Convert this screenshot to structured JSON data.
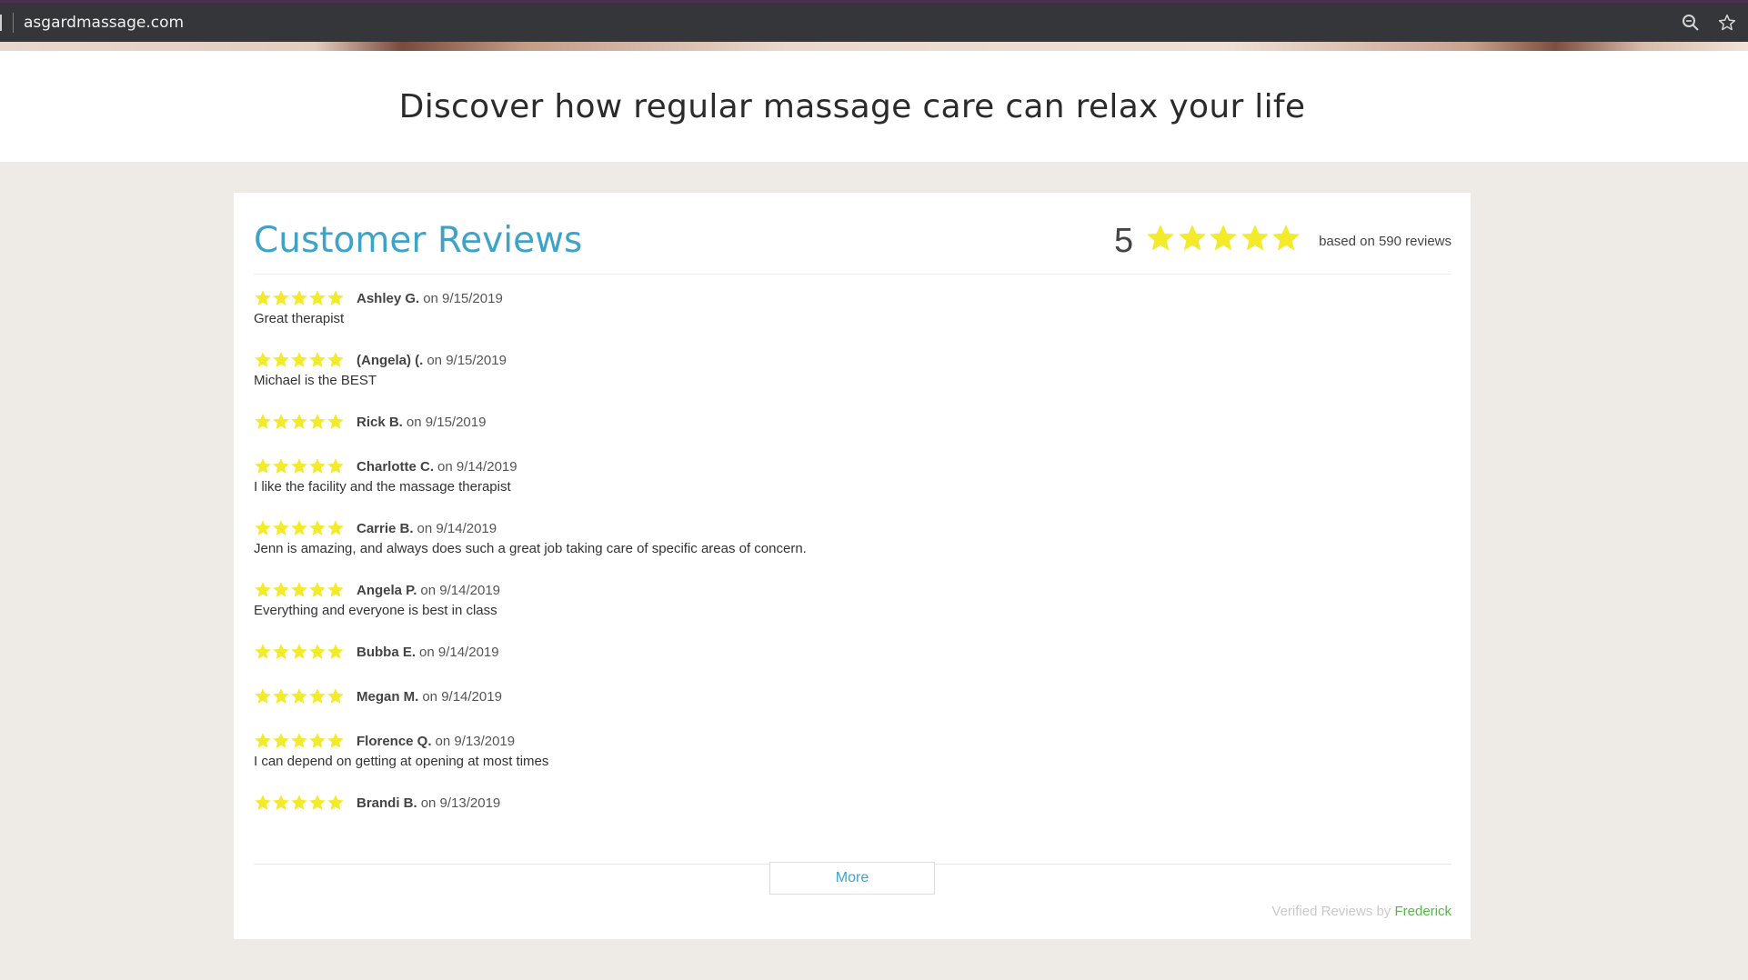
{
  "browser": {
    "url": "asgardmassage.com",
    "icons": [
      "zoom-icon",
      "bookmark-star-icon"
    ]
  },
  "page": {
    "tagline": "Discover how regular massage care can relax your life"
  },
  "reviews_widget": {
    "title": "Customer Reviews",
    "average": "5",
    "average_stars": 5,
    "based_on": "based on 590 reviews",
    "star_color": "#f3ea2a",
    "accent_color": "#3fa3c8",
    "reviews": [
      {
        "stars": 5,
        "name": "Ashley G.",
        "date": "on 9/15/2019",
        "text": "Great therapist"
      },
      {
        "stars": 5,
        "name": "(Angela) (.",
        "date": "on 9/15/2019",
        "text": "Michael is the BEST"
      },
      {
        "stars": 5,
        "name": "Rick B.",
        "date": "on 9/15/2019",
        "text": ""
      },
      {
        "stars": 5,
        "name": "Charlotte C.",
        "date": "on 9/14/2019",
        "text": "I like the facility and the massage therapist"
      },
      {
        "stars": 5,
        "name": "Carrie B.",
        "date": "on 9/14/2019",
        "text": "Jenn is amazing, and always does such a great job taking care of specific areas of concern."
      },
      {
        "stars": 5,
        "name": "Angela P.",
        "date": "on 9/14/2019",
        "text": "Everything and everyone is best in class"
      },
      {
        "stars": 5,
        "name": "Bubba E.",
        "date": "on 9/14/2019",
        "text": ""
      },
      {
        "stars": 5,
        "name": "Megan M.",
        "date": "on 9/14/2019",
        "text": ""
      },
      {
        "stars": 5,
        "name": "Florence Q.",
        "date": "on 9/13/2019",
        "text": "I can depend on getting at opening at most times"
      },
      {
        "stars": 5,
        "name": "Brandi B.",
        "date": "on 9/13/2019",
        "text": ""
      }
    ],
    "more_label": "More",
    "verified_prefix": "Verified Reviews by",
    "verified_brand": "Frederick",
    "verified_brand_color": "#58b54a"
  }
}
